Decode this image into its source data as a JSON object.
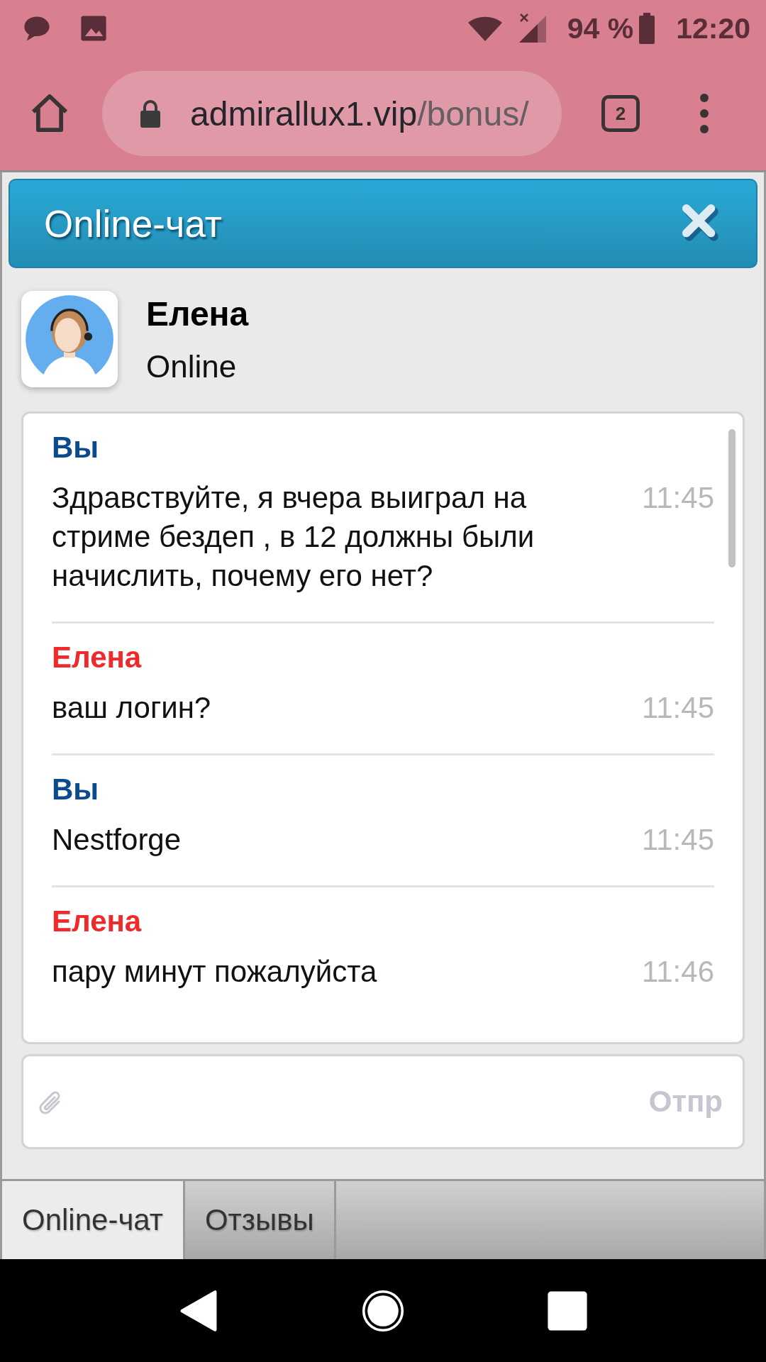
{
  "status_bar": {
    "battery": "94 %",
    "time": "12:20"
  },
  "browser": {
    "url_host": "admirallux1.vip",
    "url_path": "/bonus/",
    "tab_count": "2"
  },
  "chat": {
    "title": "Online-чат",
    "agent": {
      "name": "Елена",
      "status": "Online"
    },
    "messages": [
      {
        "sender": "Вы",
        "kind": "user",
        "text": "Здравствуйте, я вчера выиграл на стриме бездеп , в 12 должны были начислить, почему его нет?",
        "time": "11:45"
      },
      {
        "sender": "Елена",
        "kind": "agent",
        "text": "ваш логин?",
        "time": "11:45"
      },
      {
        "sender": "Вы",
        "kind": "user",
        "text": "Nestforge",
        "time": "11:45"
      },
      {
        "sender": "Елена",
        "kind": "agent",
        "text": "пару минут пожалуйста",
        "time": "11:46"
      }
    ],
    "composer": {
      "send_label": "Отпр"
    }
  },
  "tabs": [
    {
      "label": "Online-чат",
      "selected": true
    },
    {
      "label": "Отзывы",
      "selected": false
    }
  ]
}
